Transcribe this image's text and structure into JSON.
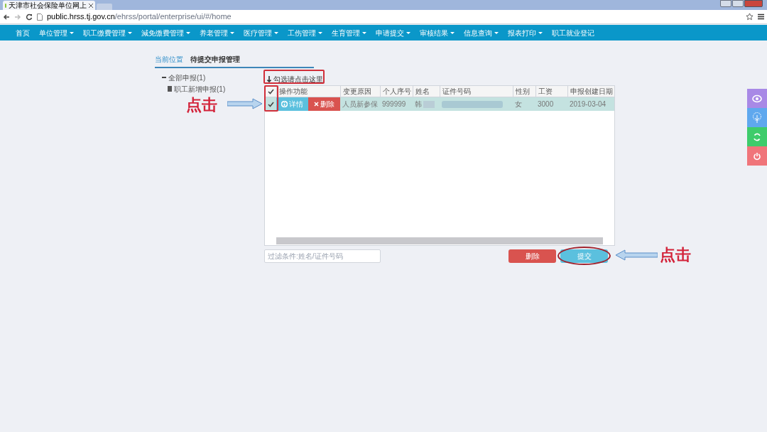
{
  "browser": {
    "tab_title": "天津市社会保险单位网上",
    "url_host": "public.hrss.tj.gov.cn",
    "url_path": "/ehrss/portal/enterprise/ui/#/home"
  },
  "nav": [
    {
      "label": "首页",
      "dropdown": false
    },
    {
      "label": "单位管理",
      "dropdown": true
    },
    {
      "label": "职工缴费管理",
      "dropdown": true
    },
    {
      "label": "減免缴费管理",
      "dropdown": true
    },
    {
      "label": "养老管理",
      "dropdown": true
    },
    {
      "label": "医疗管理",
      "dropdown": true
    },
    {
      "label": "工伤管理",
      "dropdown": true
    },
    {
      "label": "生育管理",
      "dropdown": true
    },
    {
      "label": "申请提交",
      "dropdown": true
    },
    {
      "label": "审核结果",
      "dropdown": true
    },
    {
      "label": "信息查询",
      "dropdown": true
    },
    {
      "label": "报表打印",
      "dropdown": true
    },
    {
      "label": "职工就业登记",
      "dropdown": false
    }
  ],
  "breadcrumb": {
    "label": "当前位置",
    "current": "待提交申报管理"
  },
  "tree": {
    "label": "全部申报(1)",
    "expanded": true,
    "children": [
      {
        "label": "职工新增申报(1)"
      }
    ]
  },
  "grid": {
    "select_button": "勾选请点击这里",
    "all_checked": true,
    "columns": [
      "操作功能",
      "变更原因",
      "个人序号",
      "姓名",
      "证件号码",
      "性别",
      "工资",
      "申报创建日期"
    ],
    "rows": [
      {
        "checked": true,
        "actions": [
          {
            "kind": "info",
            "label": "详情"
          },
          {
            "kind": "danger",
            "label": "删除"
          }
        ],
        "reason": "人员新参保",
        "seq": "999999",
        "name": "韩",
        "gender": "女",
        "salary": "3000",
        "date": "2019-03-04"
      }
    ]
  },
  "filter": {
    "placeholder": "过滤条件:姓名/证件号码"
  },
  "buttons": [
    {
      "kind": "danger",
      "label": "删除"
    },
    {
      "kind": "primary",
      "label": "提交"
    }
  ],
  "callouts": [
    "点击",
    "点击"
  ]
}
